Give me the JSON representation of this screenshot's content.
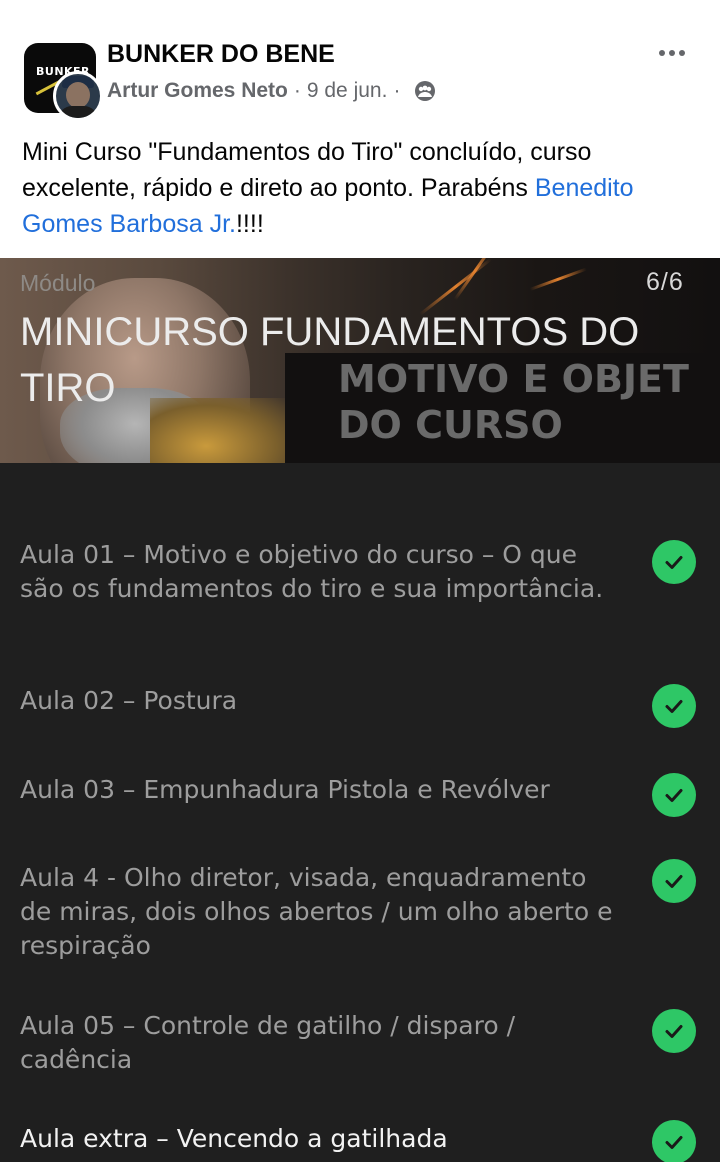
{
  "post": {
    "group_name": "BUNKER DO BENE",
    "group_avatar_text": "BUNKER",
    "author": "Artur Gomes Neto",
    "separator": "·",
    "date": "9 de jun.",
    "audience_icon": "group-icon",
    "more_icon": "more-options-icon",
    "text_before": "Mini Curso \"Fundamentos do Tiro\" concluído, curso excelente, rápido e direto ao ponto. Parabéns ",
    "mention": "Benedito Gomes Barbosa Jr.",
    "text_after": "!!!!"
  },
  "course": {
    "module_label": "Módulo",
    "counter": "6/6",
    "title": "MINICURSO FUNDAMENTOS DO TIRO",
    "thumbnail_line1": "MOTIVO E OBJET",
    "thumbnail_line2": "DO CURSO",
    "lessons": [
      {
        "title": "Aula 01 – Motivo e objetivo do curso – O que são os fundamentos do tiro e sua importância.",
        "completed": true
      },
      {
        "title": "Aula 02 – Postura",
        "completed": true
      },
      {
        "title": "Aula 03 – Empunhadura Pistola e Revólver",
        "completed": true
      },
      {
        "title": "Aula 4 - Olho diretor, visada, enquadramento de miras, dois olhos abertos / um olho aberto e respiração",
        "completed": true
      },
      {
        "title": "Aula 05 – Controle de gatilho / disparo / cadência",
        "completed": true
      },
      {
        "title": "Aula extra – Vencendo a gatilhada",
        "completed": true
      }
    ]
  },
  "colors": {
    "mention": "#216fdb",
    "check": "#2ec766",
    "lesson_text": "#9d9d9d",
    "list_background": "#1f1f1f"
  }
}
